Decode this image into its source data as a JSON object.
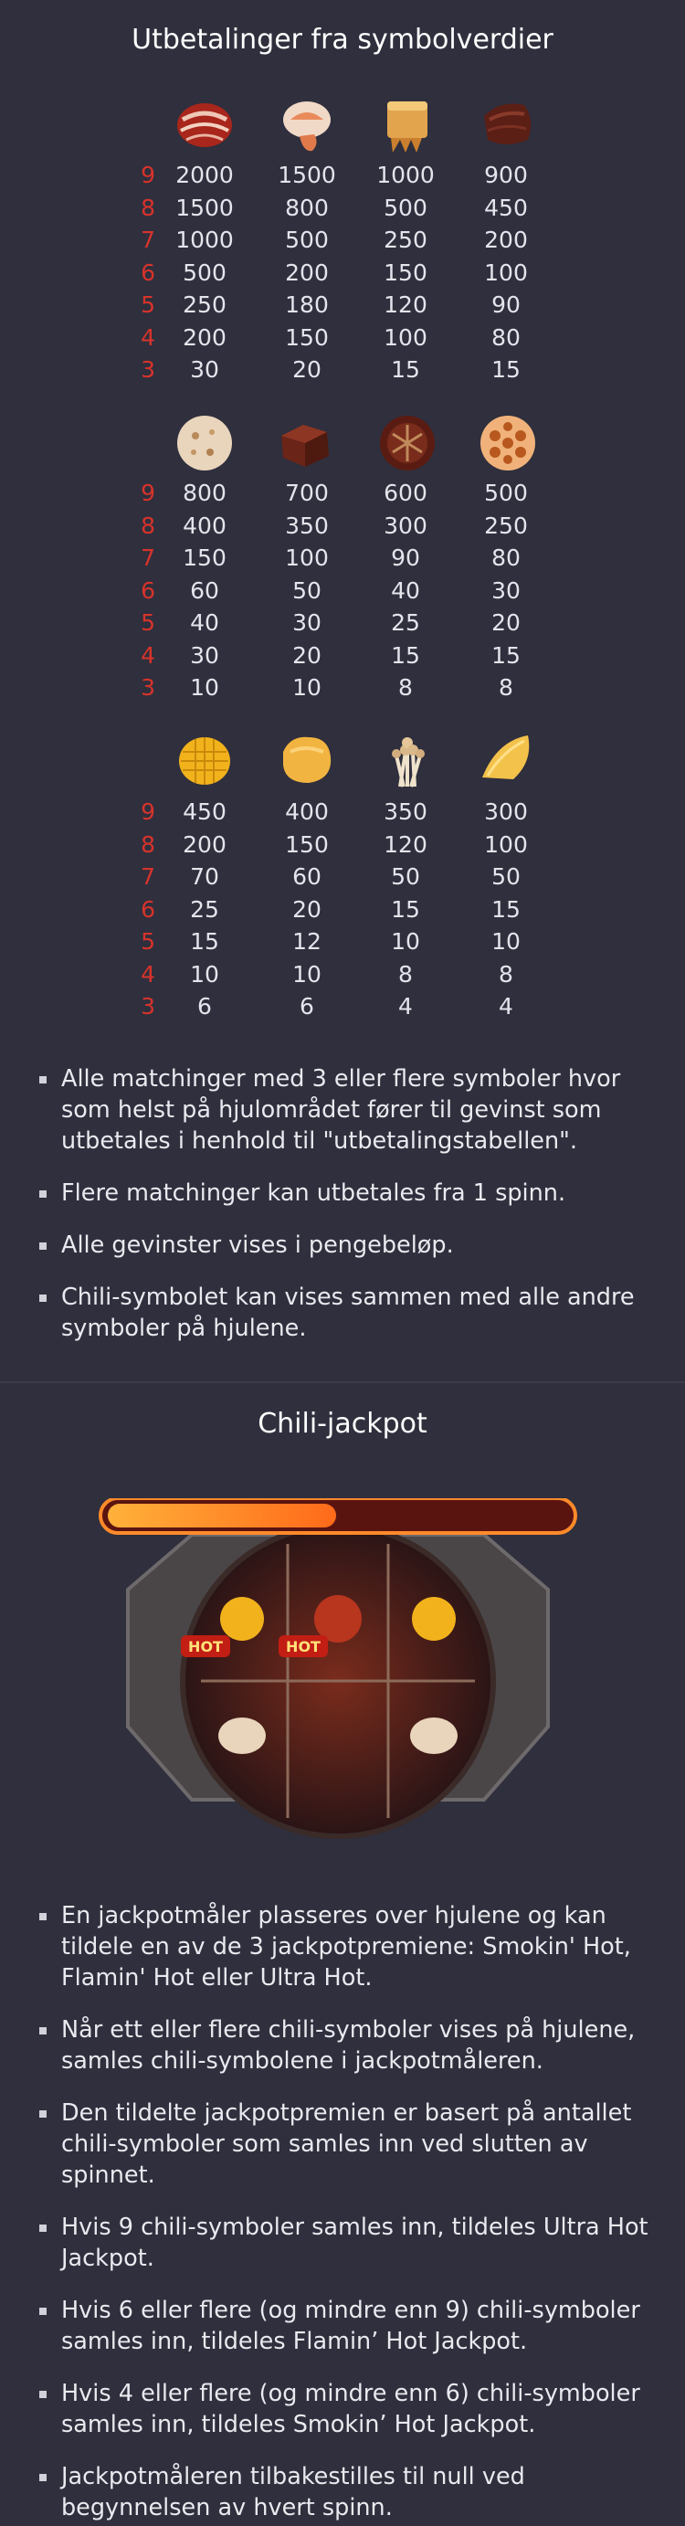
{
  "paytable": {
    "title": "Utbetalinger fra symbolverdier",
    "groups": [
      {
        "icons": [
          "bacon-icon",
          "shrimp-dumpling-icon",
          "tofu-skin-roll-icon",
          "beef-slice-icon"
        ],
        "rows": [
          {
            "count": "9",
            "values": [
              "2000",
              "1500",
              "1000",
              "900"
            ]
          },
          {
            "count": "8",
            "values": [
              "1500",
              "800",
              "500",
              "450"
            ]
          },
          {
            "count": "7",
            "values": [
              "1000",
              "500",
              "250",
              "200"
            ]
          },
          {
            "count": "6",
            "values": [
              "500",
              "200",
              "150",
              "100"
            ]
          },
          {
            "count": "5",
            "values": [
              "250",
              "180",
              "120",
              "90"
            ]
          },
          {
            "count": "4",
            "values": [
              "200",
              "150",
              "100",
              "80"
            ]
          },
          {
            "count": "3",
            "values": [
              "30",
              "20",
              "15",
              "15"
            ]
          }
        ]
      },
      {
        "icons": [
          "meatball-icon",
          "tofu-cube-icon",
          "mushroom-icon",
          "lotus-root-icon"
        ],
        "rows": [
          {
            "count": "9",
            "values": [
              "800",
              "700",
              "600",
              "500"
            ]
          },
          {
            "count": "8",
            "values": [
              "400",
              "350",
              "300",
              "250"
            ]
          },
          {
            "count": "7",
            "values": [
              "150",
              "100",
              "90",
              "80"
            ]
          },
          {
            "count": "6",
            "values": [
              "60",
              "50",
              "40",
              "30"
            ]
          },
          {
            "count": "5",
            "values": [
              "40",
              "30",
              "25",
              "20"
            ]
          },
          {
            "count": "4",
            "values": [
              "30",
              "20",
              "15",
              "15"
            ]
          },
          {
            "count": "3",
            "values": [
              "10",
              "10",
              "8",
              "8"
            ]
          }
        ]
      },
      {
        "icons": [
          "corn-icon",
          "fried-tofu-icon",
          "enoki-mushroom-icon",
          "potato-slice-icon"
        ],
        "rows": [
          {
            "count": "9",
            "values": [
              "450",
              "400",
              "350",
              "300"
            ]
          },
          {
            "count": "8",
            "values": [
              "200",
              "150",
              "120",
              "100"
            ]
          },
          {
            "count": "7",
            "values": [
              "70",
              "60",
              "50",
              "50"
            ]
          },
          {
            "count": "6",
            "values": [
              "25",
              "20",
              "15",
              "15"
            ]
          },
          {
            "count": "5",
            "values": [
              "15",
              "12",
              "10",
              "10"
            ]
          },
          {
            "count": "4",
            "values": [
              "10",
              "10",
              "8",
              "8"
            ]
          },
          {
            "count": "3",
            "values": [
              "6",
              "6",
              "4",
              "4"
            ]
          }
        ]
      }
    ],
    "rules": [
      "Alle matchinger med 3 eller flere symboler hvor som helst på hjulområdet fører til gevinst som utbetales i henhold til \"utbetalingstabellen\".",
      "Flere matchinger kan utbetales fra 1 spinn.",
      "Alle gevinster vises i pengebeløp.",
      "Chili-symbolet kan vises sammen med alle andre symboler på hjulene."
    ]
  },
  "jackpot": {
    "title": "Chili-jackpot",
    "badge_text": "HOT",
    "rules": [
      "En jackpotmåler plasseres over hjulene og kan tildele en av de 3 jackpotpremiene: Smokin' Hot, Flamin' Hot eller Ultra Hot.",
      "Når ett eller flere chili-symboler vises på hjulene, samles chili-symbolene i jackpotmåleren.",
      "Den tildelte jackpotpremien er basert på antallet chili-symboler som samles inn ved slutten av spinnet.",
      "Hvis 9 chili-symboler samles inn, tildeles Ultra Hot Jackpot.",
      "Hvis 6 eller flere (og mindre enn 9) chili-symboler samles inn, tildeles Flamin’    Hot Jackpot.",
      "Hvis 4 eller flere (og mindre enn 6) chili-symboler samles inn, tildeles Smokin’    Hot Jackpot.",
      "Jackpotmåleren tilbakestilles til null ved begynnelsen av hvert spinn."
    ]
  }
}
